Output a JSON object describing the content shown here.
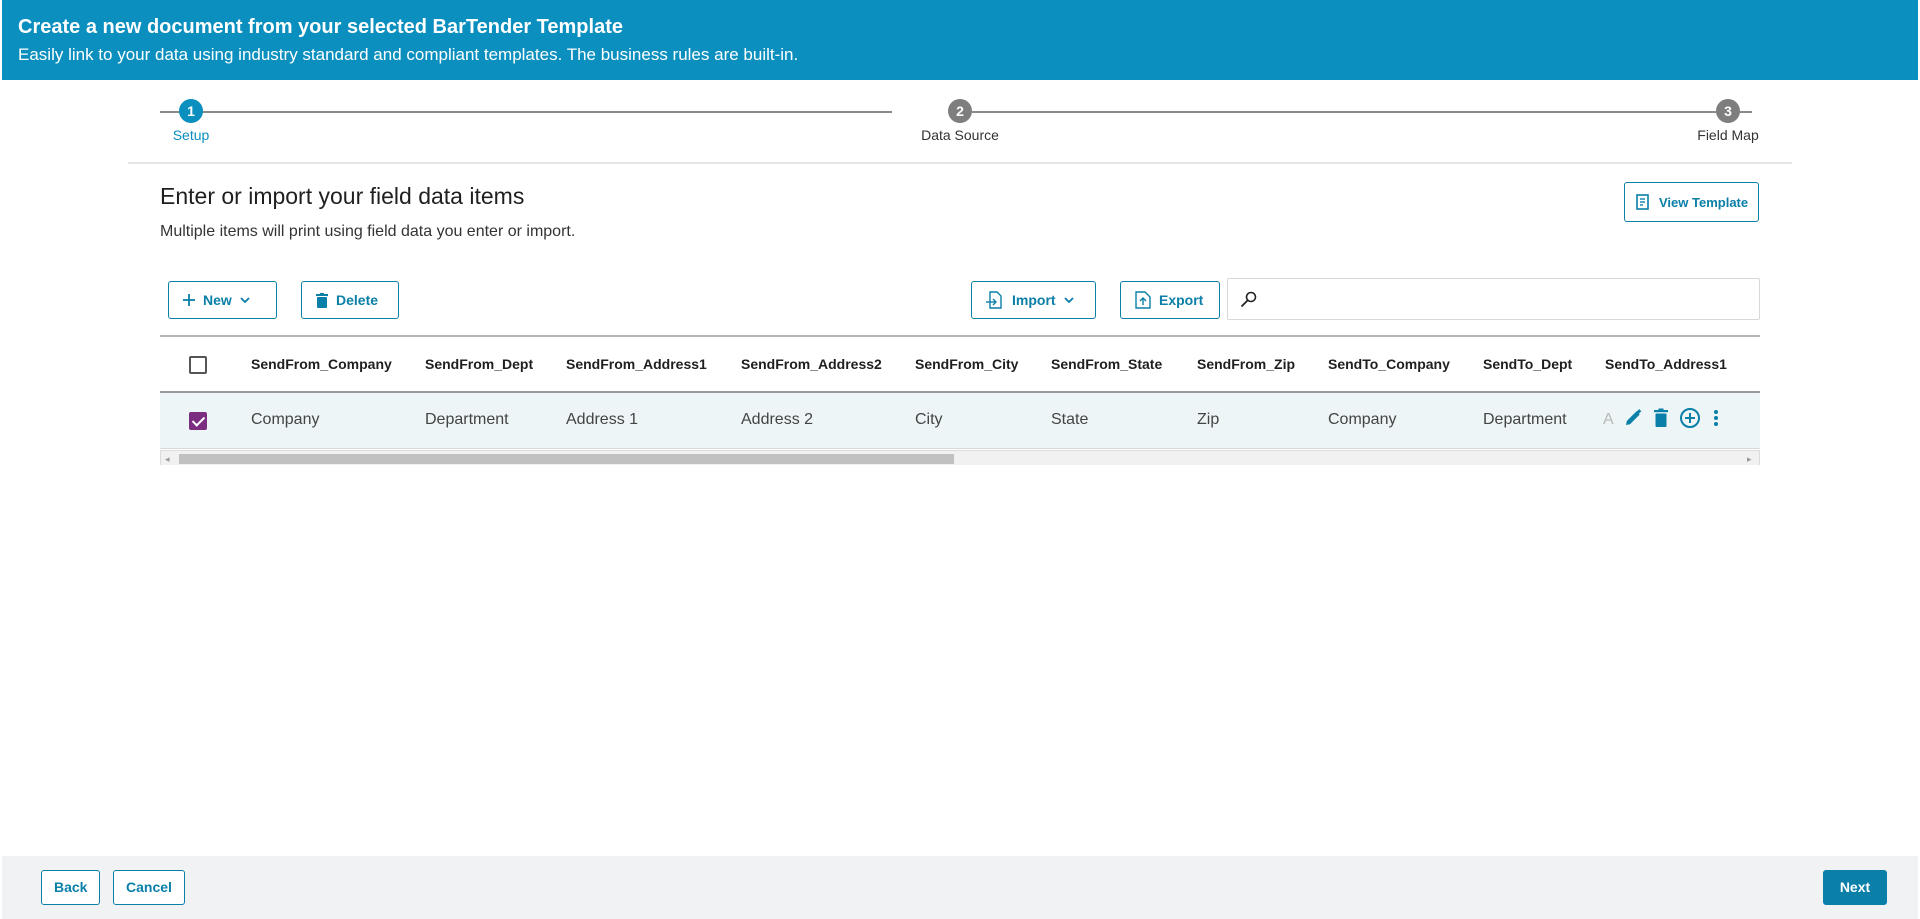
{
  "banner": {
    "title": "Create a new document from your selected BarTender Template",
    "subtitle": "Easily link to your data using industry standard and compliant templates. The business rules are built-in."
  },
  "stepper": {
    "steps": [
      {
        "number": "1",
        "label": "Setup",
        "state": "active"
      },
      {
        "number": "2",
        "label": "Data Source",
        "state": "inactive"
      },
      {
        "number": "3",
        "label": "Field Map",
        "state": "inactive"
      }
    ]
  },
  "content": {
    "heading": "Enter or import your field data items",
    "subheading": "Multiple items will print using field data you enter or import.",
    "view_template_label": "View Template"
  },
  "toolbar": {
    "new_label": "New",
    "delete_label": "Delete",
    "import_label": "Import",
    "export_label": "Export",
    "search_value": "",
    "search_placeholder": ""
  },
  "grid": {
    "columns": [
      "SendFrom_Company",
      "SendFrom_Dept",
      "SendFrom_Address1",
      "SendFrom_Address2",
      "SendFrom_City",
      "SendFrom_State",
      "SendFrom_Zip",
      "SendTo_Company",
      "SendTo_Dept",
      "SendTo_Address1"
    ],
    "rows": [
      {
        "checked": true,
        "cells": [
          "Company",
          "Department",
          "Address 1",
          "Address 2",
          "City",
          "State",
          "Zip",
          "Company",
          "Department",
          "A"
        ]
      }
    ]
  },
  "footer": {
    "back_label": "Back",
    "cancel_label": "Cancel",
    "next_label": "Next"
  },
  "colors": {
    "accent": "#0a8fbf",
    "button_border": "#0a7fa8",
    "checkbox_checked": "#7b2d7f",
    "row_selected": "#edf5f7"
  }
}
